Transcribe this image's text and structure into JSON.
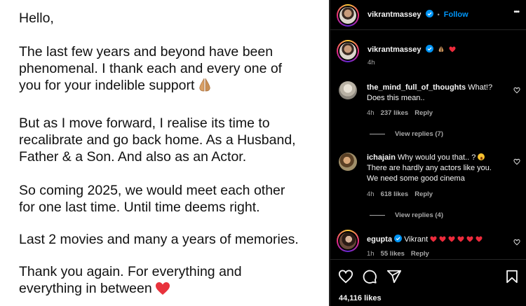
{
  "post_image": {
    "greeting": "Hello,",
    "p1_line1": "The last few years and beyond have been",
    "p1_line2": "phenomenal. I thank each and every one of",
    "p1_line3": "you for your indelible support",
    "p2_line1": "But as I move forward, I realise its time to",
    "p2_line2": "recalibrate and go back home. As a Husband,",
    "p2_line3": "Father & a Son. And also as an Actor.",
    "p3_line1": "So coming 2025, we would meet each other",
    "p3_line2": "for one last time. Until time deems right.",
    "p4_line1": "Last 2 movies and many a years of memories.",
    "p5_line1": "Thank you again. For everything and",
    "p5_line2": "everything in between"
  },
  "header": {
    "username": "vikrantmassey",
    "separator": "•",
    "follow_label": "Follow",
    "more_label": "•••"
  },
  "caption": {
    "username": "vikrantmassey",
    "time": "4h"
  },
  "comments": [
    {
      "username": "the_mind_full_of_thoughts",
      "text_line1": "What!?",
      "text_line2": "Does this mean..",
      "time": "4h",
      "likes": "237 likes",
      "reply_label": "Reply",
      "view_replies": "View replies (7)"
    },
    {
      "username": "ichajain",
      "text_line1": "Why would you that.. ?",
      "text_line2": "There are hardly any actors like you.",
      "text_line3": "We need some good cinema",
      "time": "4h",
      "likes": "618 likes",
      "reply_label": "Reply",
      "view_replies": "View replies (4)"
    },
    {
      "username": "egupta",
      "text_line1": "Vikrant",
      "time": "1h",
      "likes": "55 likes",
      "reply_label": "Reply"
    }
  ],
  "footer": {
    "likes_count": "44,116 likes"
  },
  "icons": {
    "verified": "verified-badge-icon",
    "heart": "heart-icon",
    "comment": "comment-icon",
    "share": "share-icon",
    "save": "bookmark-icon"
  },
  "colors": {
    "accent_blue": "#0095f6",
    "heart_red": "#ed2b3c",
    "muted": "#a8a8a8"
  }
}
